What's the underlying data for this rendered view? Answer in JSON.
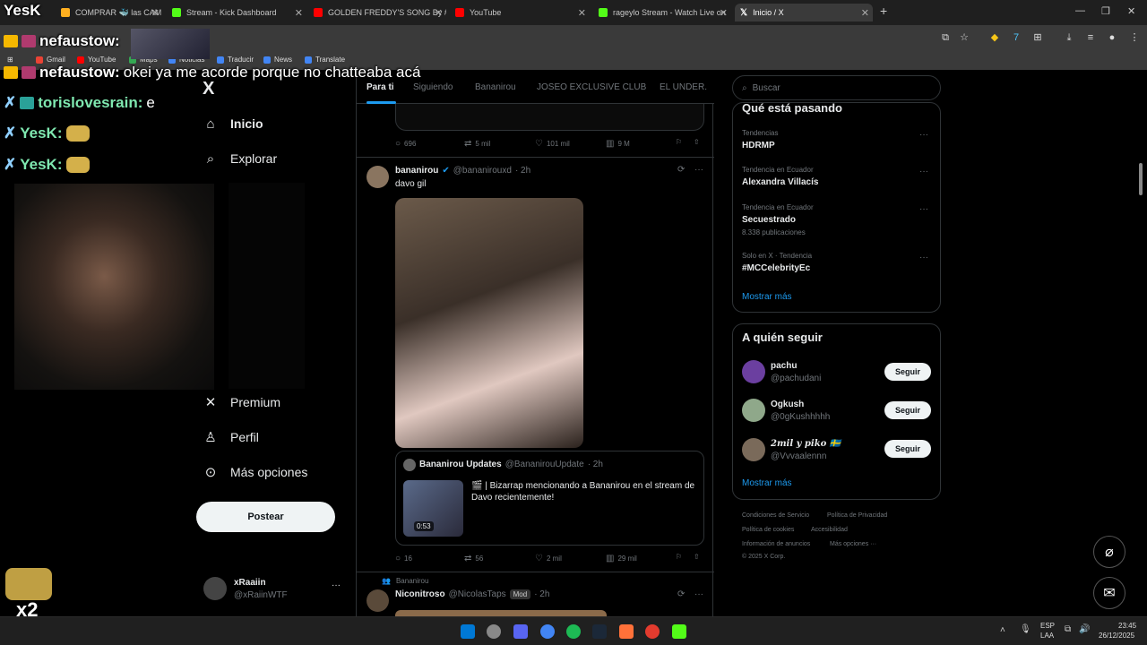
{
  "browser": {
    "tabs": [
      {
        "label": "COMPRAR 🐳 las CAM",
        "color": "#ffb020"
      },
      {
        "label": "Stream - Kick Dashboard",
        "color": "#53fc18"
      },
      {
        "label": "GOLDEN FREDDY'S SONG By #",
        "color": "#ff0000"
      },
      {
        "label": "YouTube",
        "color": "#ff0000"
      },
      {
        "label": "rageylo Stream - Watch Live on",
        "color": "#53fc18"
      },
      {
        "label": "Inicio / X",
        "color": "#ffffff"
      }
    ],
    "new_tab": "+",
    "bookmarks": [
      {
        "label": "Gmail",
        "color": "#ea4335"
      },
      {
        "label": "YouTube",
        "color": "#ff0000"
      },
      {
        "label": "Maps",
        "color": "#34a853"
      },
      {
        "label": "Noticias",
        "color": "#4285f4"
      },
      {
        "label": "Traducir",
        "color": "#4285f4"
      },
      {
        "label": "News",
        "color": "#4285f4"
      },
      {
        "label": "Translate",
        "color": "#4285f4"
      }
    ]
  },
  "stream_overlay": {
    "title": "YesK",
    "lines": [
      {
        "user": "nefaustow:",
        "text": ""
      },
      {
        "user": "nefaustow:",
        "text": "okei ya me acorde porque no chatteaba acá"
      },
      {
        "user": "torislovesrain:",
        "text": "e"
      },
      {
        "user": "YesK:",
        "text": ""
      },
      {
        "user": "YesK:",
        "text": ""
      }
    ],
    "corner_label": "x2"
  },
  "x_nav": {
    "logo": "X",
    "items": [
      {
        "label": "Inicio",
        "icon": "home-icon"
      },
      {
        "label": "Explorar",
        "icon": "search-icon"
      },
      {
        "label": "Premium",
        "icon": "x-icon"
      },
      {
        "label": "Perfil",
        "icon": "person-icon"
      },
      {
        "label": "Más opciones",
        "icon": "more-icon"
      }
    ],
    "post_button": "Postear",
    "account": {
      "name": "xRaaiin",
      "handle": "@xRaiinWTF",
      "more": "···"
    }
  },
  "feed": {
    "tabs": [
      "Para ti",
      "Siguiendo",
      "Bananirou",
      "JOSEO EXCLUSIVE CLUB",
      "EL UNDER."
    ],
    "prev_stats": {
      "replies": "696",
      "reposts": "5 mil",
      "likes": "101 mil",
      "views": "9 M"
    },
    "post": {
      "name": "bananirou",
      "handle": "@bananirouxd",
      "time": "· 2h",
      "text": "davo gil",
      "quote": {
        "name": "Bananirou Updates",
        "handle": "@BananirouUpdate",
        "time": "· 2h",
        "text": "🎬 | Bizarrap mencionando a Bananirou en el stream de Davo recientemente!",
        "duration": "0:53"
      },
      "stats": {
        "replies": "16",
        "reposts": "56",
        "likes": "2 mil",
        "views": "29 mil"
      }
    },
    "next_post": {
      "context": "Bananirou",
      "name": "Niconitroso",
      "handle": "@NicolasTaps",
      "badge": "Mod",
      "time": "· 2h"
    }
  },
  "sidebar": {
    "search_placeholder": "Buscar",
    "trends_title": "Qué está pasando",
    "trends": [
      {
        "category": "Tendencias",
        "name": "HDRMP",
        "posts": ""
      },
      {
        "category": "Tendencia en Ecuador",
        "name": "Alexandra Villacís",
        "posts": ""
      },
      {
        "category": "Tendencia en Ecuador",
        "name": "Secuestrado",
        "posts": "8.338 publicaciones"
      },
      {
        "category": "Solo en X · Tendencia",
        "name": "#MCCelebrityEc",
        "posts": ""
      }
    ],
    "show_more": "Mostrar más",
    "follow_title": "A quién seguir",
    "follow": [
      {
        "name": "pachu",
        "handle": "@pachudani",
        "button": "Seguir",
        "color": "#6b3fa0"
      },
      {
        "name": "Ogkush",
        "handle": "@0gKushhhhh",
        "button": "Seguir",
        "color": "#8fa88a"
      },
      {
        "name": "2mil y piko 🇸🇪",
        "handle": "@Vvvaalennn",
        "button": "Seguir",
        "color": "#7a6a5a"
      }
    ],
    "show_more_2": "Mostrar más",
    "footer": [
      "Condiciones de Servicio",
      "Política de Privacidad",
      "Política de cookies",
      "Accesibilidad",
      "Información de anuncios",
      "Más opciones ···",
      "© 2025 X Corp."
    ]
  },
  "taskbar": {
    "lang": "ESP",
    "lang2": "LAA",
    "time": "23:45",
    "date": "26/12/2025",
    "apps": [
      "#0078d4",
      "#888888",
      "#5865f2",
      "#4285f4",
      "#1db954",
      "#1b2838",
      "#ff7139",
      "#e33b2e",
      "#53fc18"
    ]
  }
}
